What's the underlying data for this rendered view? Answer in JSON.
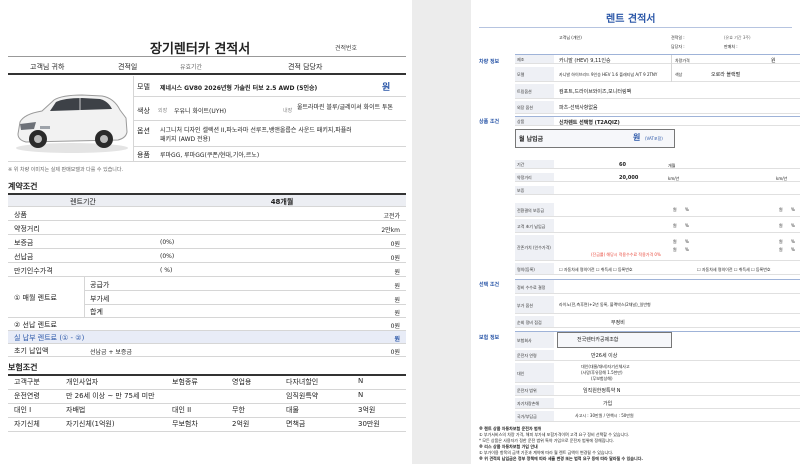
{
  "left": {
    "title": "장기렌터카 견적서",
    "quote_no_label": "견적번호",
    "customer": {
      "name_label": "고객님 귀하",
      "date_label": "견적일",
      "company_label": "유효기간",
      "manager_label": "견적 담당자"
    },
    "vehicle": {
      "model_label": "모델",
      "model_value": "제네시스 GV80 2026년형 가솔린 터보 2.5 AWD (5인승)",
      "price_unit": "원",
      "color_label": "색상",
      "exterior_label": "외장",
      "exterior_value": "우유니 화이트(UYH)",
      "interior_label": "내장",
      "interior_value": "울트라마린 블루/글레이셔 화이트 투톤",
      "option_label": "옵션",
      "option_value_1": "시그니처 디자인 셀렉션 II,파노라마 선루프,뱅앤올룹슨 사운드 패키지,파퓰러",
      "option_value_2": "패키지 (AWD 전용)",
      "use_label": "용품",
      "use_value": "루마GG, 루마GG(쿠폰/현대,기아,르노)",
      "notice": "※ 위 차량 이미지는 실제 판매모델과 다를 수 있습니다."
    },
    "contract": {
      "section_title": "계약조건",
      "period_label": "렌트기간",
      "period_value": "48개월",
      "rows": {
        "product": {
          "label": "상품",
          "value": "고전가"
        },
        "mileage": {
          "label": "약정거리",
          "value": "2만km"
        },
        "deposit": {
          "label": "보증금",
          "pct": "(0%)",
          "value": "0원"
        },
        "prepay": {
          "label": "선납금",
          "pct": "(0%)",
          "value": "0원"
        },
        "residual": {
          "label": "만기인수가격",
          "pct": "(    %)",
          "value": "원"
        },
        "monthly_label": "① 매월 렌트료",
        "supply": {
          "label": "공급가",
          "value": "원"
        },
        "vat": {
          "label": "부가세",
          "value": "원"
        },
        "sum": {
          "label": "합계",
          "value": "원"
        },
        "prepaid_rent": {
          "label": "② 선납 렌트료",
          "value": "0원"
        },
        "actual": {
          "label": "실 납부 렌트료 (① - ②)",
          "value": "원"
        },
        "initial": {
          "label": "초기 납입액",
          "sub": "선납금 + 보증금",
          "value": "0원"
        }
      }
    },
    "insurance": {
      "section_title": "보험조건",
      "rows": [
        [
          "고객구분",
          "개인사업자",
          "보험종류",
          "영업용",
          "다자녀할인",
          "N"
        ],
        [
          "운전연령",
          "만 26세 이상 ~ 만 75세 미만",
          "",
          "",
          "임직원특약",
          "N"
        ],
        [
          "대인 I",
          "자배법",
          "대인 II",
          "무한",
          "대물",
          "3억원"
        ],
        [
          "자기신체",
          "자기신체(1억원)",
          "무보험차",
          "2억원",
          "면책금",
          "30만원"
        ]
      ]
    }
  },
  "right": {
    "title": "렌트 견적서",
    "customer": {
      "label": "고객님 (개인)",
      "date_label": "견적일 :",
      "valid_label": "(유효 기간 3주)",
      "manager_label": "담당자 :",
      "sales_label": "판매처 :"
    },
    "vehicle_section": "차량 정보",
    "vehicle": {
      "maker_label": "제조",
      "maker_value": "카니발 (HEV) 9,11인승",
      "model_label": "모델",
      "model_value": "카니발 하이브리드 9인승 HEV 1.6 플래티넘 A/T 9 2TNY",
      "trim_label": "트림옵션",
      "trim_value": "컴포트,드라이브와이즈,모니터링팩",
      "color_label": "외장 옵션",
      "color_value": "파츠-선택사항없음",
      "price_label": "차량가격",
      "price_value": "원",
      "ext_label": "색상",
      "ext_value": "오로라 블랙펄"
    },
    "product_section": "상품 조건",
    "product": {
      "type_label": "상품",
      "type_value": "신차렌트 선택형 (T2AQIZ)",
      "monthly_label": "월 납입금",
      "monthly_value": "원",
      "monthly_note": "(VAT포함)"
    },
    "terms": {
      "period_label": "기간",
      "period_value": "60",
      "period_unit": "개월",
      "km_label": "약정거리",
      "km_value": "20,000",
      "km_unit": "km/년",
      "deposit_label": "보증",
      "won": "원",
      "pct": "%",
      "row4_label": "전환결의 보증금",
      "row5_label": "고객 초기 납입금",
      "row6_label": "잔존가치 (인수가격)",
      "note_red": "(잔금률) 해당시 적용수수료 적용가격 0%",
      "row7_label": "명의(등록)",
      "check_a": "☐ 자동차세 명의이전 ☐ 취득세 ☐ 등록번호",
      "check_b": "☐ 자동차세 명의이전 ☐ 취득세 ☐ 등록번호"
    },
    "option_section": "선택 조건",
    "options": {
      "maint_label": "정비 수수료 결정",
      "maint_value": "",
      "extra_label": "부가 옵션",
      "extra_value": "라이노(전,측후면)+2년 동록, 블랙박스(2채널)_일반형",
      "service_label": "순회 정비 점검",
      "service_value": "무정비"
    },
    "insurance_section": "보험 정보",
    "insurance": {
      "ins_label": "보험회사",
      "ins_value": "전국렌터카공제조합",
      "age_label": "운전자 연령",
      "age_value": "만26세 이상",
      "bodily_label": "대인",
      "bodily_value_1": "대인(대물/대비)자기신체사고",
      "bodily_value_2": "(사망/후유장해 1.5천만)",
      "bodily_value_3": "(무보험상해)",
      "scope_label": "운전자 범위",
      "scope_value": "임직원한정특약 N",
      "self_label": "자기차량손해",
      "self_value": "가입",
      "deduct_label": "국가/부담금",
      "deduct_value": "사고시 : 30만원 / 면책시 : 50만원"
    },
    "footnotes": [
      "※ 렌트 상품 자동차보험 운전자 범위",
      "① 부가서비스의 차량 가격, 해피 부가세 포함가격이며 고객 요구 정비 선택할 수 있습니다.",
      "* 모든 상품은 사용자가 정한 운전 범위 특약 가입으로 운전자 범위에 정해집니다.",
      "※ 리스 상품 자동차보험 가입 안내",
      "① 부가이용 항목의 금액 기준과 계약에 따라 월 렌트 금액이 변경될 수 있습니다.",
      "※ 위 견적의 납입금은 정부 정책에 따라 세율 변경 또는 법적 요구 등에 따라 달라질 수 있습니다."
    ]
  }
}
